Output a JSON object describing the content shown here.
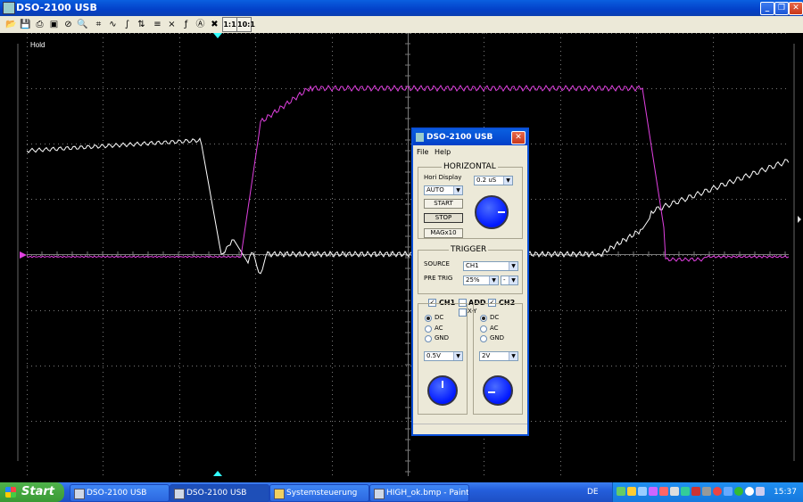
{
  "window": {
    "title": "DSO-2100 USB"
  },
  "toolbar": {
    "icons": [
      "open-icon",
      "save-icon",
      "print-icon",
      "print-preview-icon",
      "clear-icon",
      "zoom-icon",
      "cursor-icon",
      "waveform-icon",
      "math-icon",
      "trigger-icon",
      "grid-icon",
      "close-x-icon",
      "fft-icon",
      "math-a-icon",
      "x-icon"
    ],
    "ratio1": "1:1",
    "ratio10": "10:1"
  },
  "scope": {
    "hold_label": "Hold",
    "colors": {
      "ch1": "#ffffff",
      "ch2": "#e040e0",
      "grid": "#7a7a7a"
    }
  },
  "dialog": {
    "title": "DSO-2100 USB",
    "menu": {
      "file": "File",
      "help": "Help"
    },
    "horizontal": {
      "title": "HORIZONTAL",
      "hori_display_label": "Hori Display",
      "mode_value": "AUTO",
      "timebase_value": "0.2 uS",
      "start_label": "START",
      "stop_label": "STOP",
      "mag_label": "MAGx10"
    },
    "trigger": {
      "title": "TRIGGER",
      "source_label": "SOURCE",
      "source_value": "CH1",
      "pretrig_label": "PRE TRIG",
      "pretrig_value": "25%",
      "slope_value": "-"
    },
    "channels": {
      "ch1_label": "CH1",
      "add_label": "ADD",
      "ch2_label": "CH2",
      "xy_label": "X-Y",
      "coupling": [
        "DC",
        "AC",
        "GND"
      ],
      "ch1_volts": "0.5V",
      "ch2_volts": "2V"
    }
  },
  "taskbar": {
    "start": "Start",
    "tasks": [
      "DSO-2100 USB",
      "DSO-2100 USB",
      "Systemsteuerung",
      "HIGH_ok.bmp - Paint"
    ],
    "language": "DE",
    "clock": "15:37"
  }
}
